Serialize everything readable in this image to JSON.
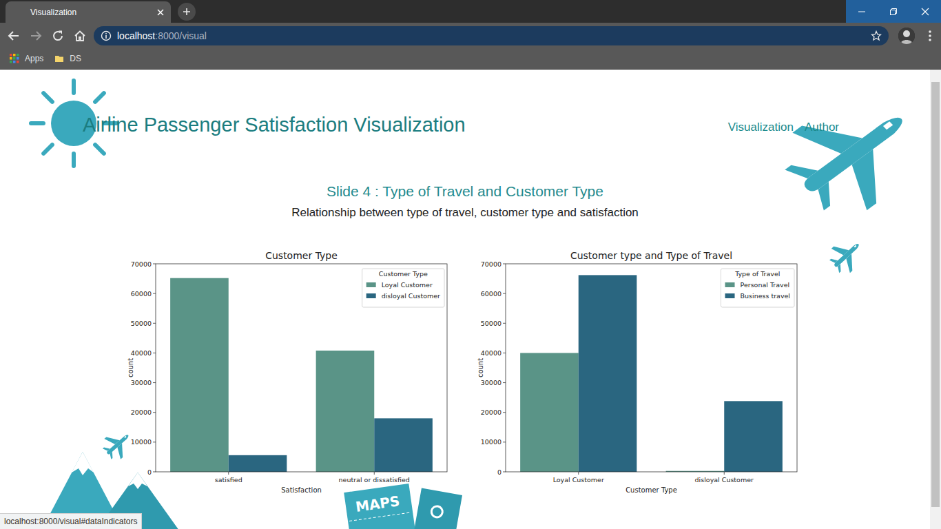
{
  "tabs": [
    {
      "label": "Visualization",
      "selected": true
    }
  ],
  "address_bar": {
    "host": "localhost",
    "path": ":8000/visual"
  },
  "bookmarks": [
    "Apps",
    "DS"
  ],
  "page": {
    "title": "Airline Passenger Satisfaction Visualization",
    "nav": [
      "Visualization",
      "Author"
    ],
    "slide_title": "Slide 4 : Type of Travel and Customer Type",
    "slide_subtitle": "Relationship between type of travel, customer type and satisfaction",
    "maps_label": "MAPS"
  },
  "charts": [
    {
      "title": "Customer Type",
      "y_label": "count",
      "x_label": "Satisfaction",
      "y_ticks": [
        "0",
        "10000",
        "20000",
        "30000",
        "40000",
        "50000",
        "60000",
        "70000"
      ],
      "categories": [
        "satisfied",
        "neutral or dissatisfied"
      ],
      "legend_title": "Customer Type",
      "series": [
        {
          "name": "Loyal Customer",
          "color": "#5a9487",
          "values": [
            65200,
            40800
          ]
        },
        {
          "name": "disloyal Customer",
          "color": "#2a6680",
          "values": [
            5600,
            18000
          ]
        }
      ]
    },
    {
      "title": "Customer type and Type of Travel",
      "y_label": "count",
      "x_label": "Customer Type",
      "y_ticks": [
        "0",
        "10000",
        "20000",
        "30000",
        "40000",
        "50000",
        "60000",
        "70000"
      ],
      "categories": [
        "Loyal Customer",
        "disloyal Customer"
      ],
      "legend_title": "Type of Travel",
      "series": [
        {
          "name": "Personal Travel",
          "color": "#5a9487",
          "values": [
            40000,
            300
          ]
        },
        {
          "name": "Business travel",
          "color": "#2a6680",
          "values": [
            66200,
            23800
          ]
        }
      ]
    }
  ],
  "status_bar": "localhost:8000/visual#dataIndicators"
}
